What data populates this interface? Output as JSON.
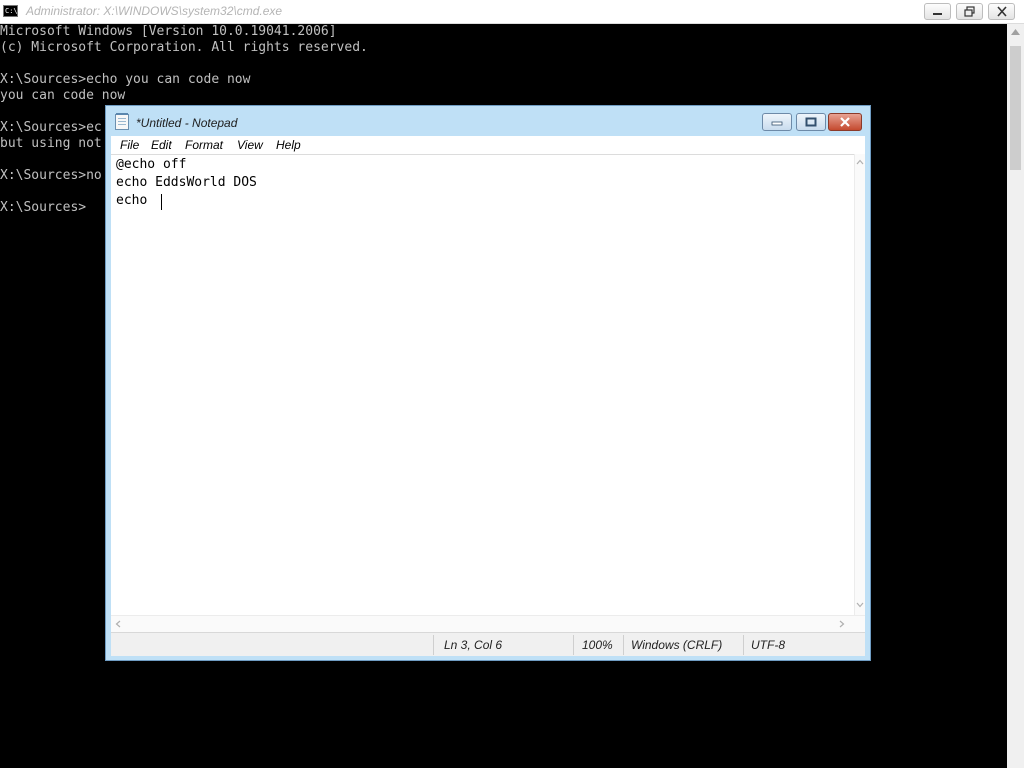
{
  "cmd": {
    "title": "Administrator: X:\\WINDOWS\\system32\\cmd.exe",
    "icon_label": "C:\\",
    "lines": [
      "Microsoft Windows [Version 10.0.19041.2006]",
      "(c) Microsoft Corporation. All rights reserved.",
      "",
      "X:\\Sources>echo you can code now",
      "you can code now",
      "",
      "X:\\Sources>ec",
      "but using not",
      "",
      "X:\\Sources>no",
      "",
      "X:\\Sources>"
    ]
  },
  "notepad": {
    "title": "*Untitled - Notepad",
    "menu": {
      "file": "File",
      "edit": "Edit",
      "format": "Format",
      "view": "View",
      "help": "Help"
    },
    "content_lines": [
      "@echo off",
      "echo EddsWorld DOS",
      "echo "
    ],
    "status": {
      "position": "Ln 3, Col 6",
      "zoom": "100%",
      "line_ending": "Windows (CRLF)",
      "encoding": "UTF-8"
    }
  },
  "colors": {
    "console_background": "#000000",
    "console_text": "#c0c0c0",
    "notepad_frame": "#bfe0f6",
    "close_button": "#c44a2f"
  }
}
